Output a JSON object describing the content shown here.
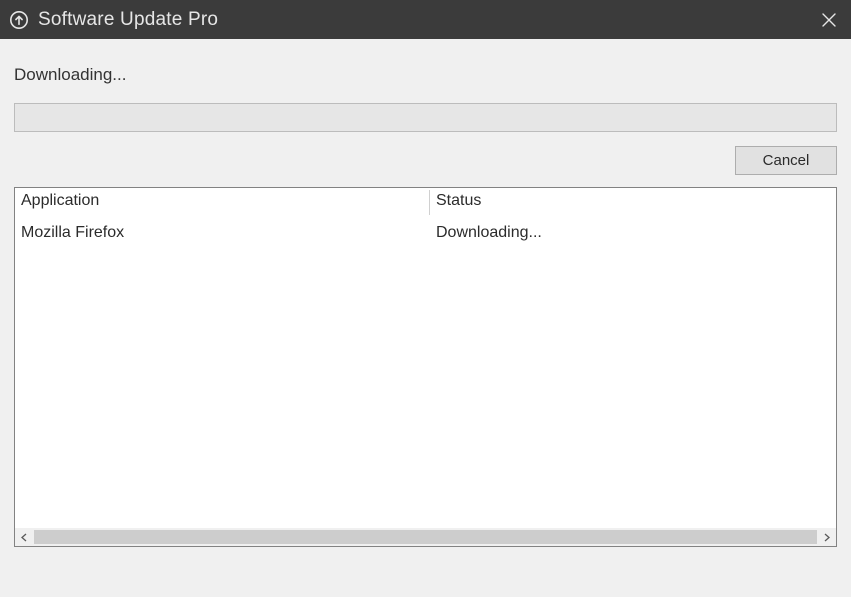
{
  "window": {
    "title": "Software Update Pro"
  },
  "status": {
    "text": "Downloading..."
  },
  "buttons": {
    "cancel": "Cancel"
  },
  "table": {
    "columns": {
      "application": "Application",
      "status": "Status"
    },
    "rows": [
      {
        "application": "Mozilla Firefox",
        "status": "Downloading..."
      }
    ]
  }
}
